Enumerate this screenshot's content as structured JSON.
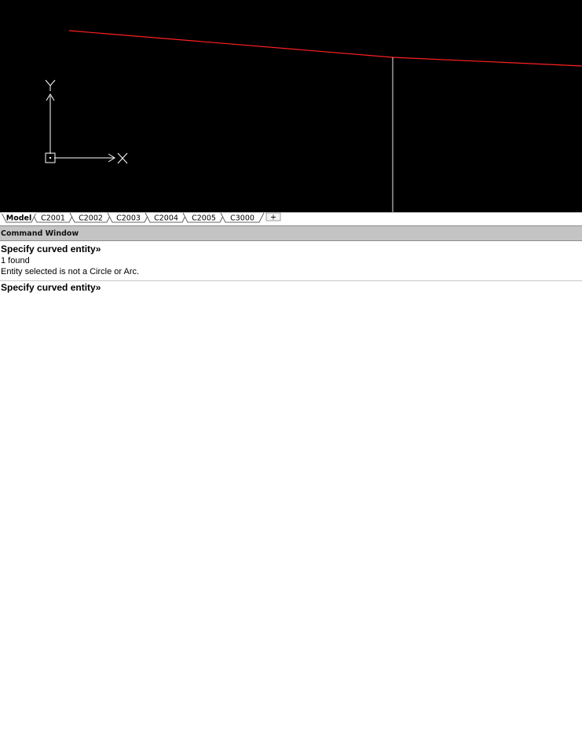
{
  "canvas": {
    "background": "#000000",
    "line_color": "#ff2020",
    "ucs_color": "#ffffff",
    "ucs": {
      "y_label": "Y",
      "x_label": "X"
    }
  },
  "tabs": [
    {
      "label": "Model",
      "active": true
    },
    {
      "label": "C2001",
      "active": false
    },
    {
      "label": "C2002",
      "active": false
    },
    {
      "label": "C2003",
      "active": false
    },
    {
      "label": "C2004",
      "active": false
    },
    {
      "label": "C2005",
      "active": false
    },
    {
      "label": "C3000",
      "active": false
    }
  ],
  "add_tab_symbol": "+",
  "command_window": {
    "title": "Command Window",
    "history": [
      {
        "text": "Specify curved entity»",
        "kind": "prompt"
      },
      {
        "text": "1 found",
        "kind": "message"
      },
      {
        "text": "Entity selected is not a Circle or Arc.",
        "kind": "message"
      }
    ],
    "current_prompt": "Specify curved entity»"
  }
}
